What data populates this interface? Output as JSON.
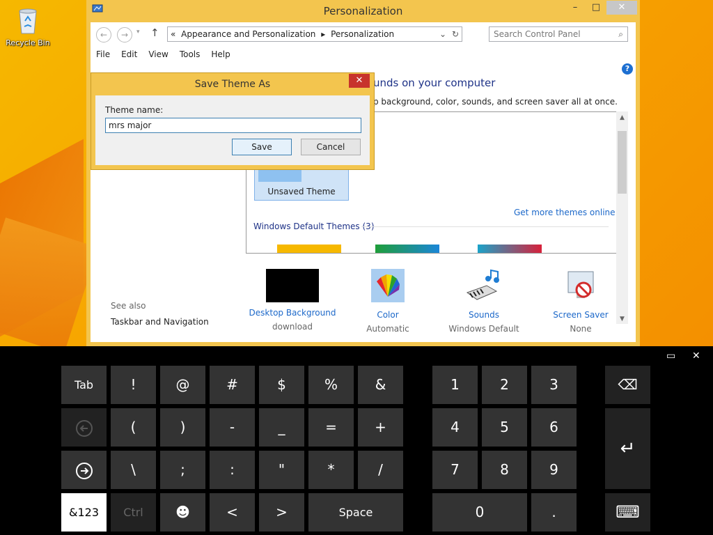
{
  "desktop": {
    "recycle_bin_label": "Recycle Bin"
  },
  "window": {
    "title": "Personalization",
    "controls": {
      "minimize": "–",
      "maximize": "□",
      "close": "✕"
    },
    "breadcrumb": {
      "prefix": "«",
      "items": [
        "Appearance and Personalization",
        "Personalization"
      ]
    },
    "search_placeholder": "Search Control Panel",
    "menu": [
      "File",
      "Edit",
      "View",
      "Tools",
      "Help"
    ],
    "heading": "unds on your computer",
    "subheading": "p background, color, sounds, and screen saver all at once.",
    "unsaved_theme_label": "Unsaved Theme",
    "get_more_themes": "Get more themes online",
    "windows_default_themes": "Windows Default Themes (3)",
    "see_also": "See also",
    "taskbar_navigation": "Taskbar and Navigation",
    "options": [
      {
        "label": "Desktop Background",
        "value": "download",
        "icon": "desktop-background-icon"
      },
      {
        "label": "Color",
        "value": "Automatic",
        "icon": "color-icon"
      },
      {
        "label": "Sounds",
        "value": "Windows Default",
        "icon": "sounds-icon"
      },
      {
        "label": "Screen Saver",
        "value": "None",
        "icon": "screen-saver-icon"
      }
    ],
    "help": "?"
  },
  "dialog": {
    "title": "Save Theme As",
    "close": "✕",
    "field_label": "Theme name:",
    "field_value": "mrs major",
    "save": "Save",
    "cancel": "Cancel"
  },
  "keyboard": {
    "minimize": "▭",
    "close": "✕",
    "symbols_row1": [
      "Tab",
      "!",
      "@",
      "#",
      "$",
      "%",
      "&"
    ],
    "symbols_row2": [
      "",
      "(",
      ")",
      "-",
      "_",
      "=",
      "+"
    ],
    "symbols_row3": [
      "",
      "\\",
      ";",
      ":",
      "\"",
      "*",
      "/"
    ],
    "bottom_row": [
      "&123",
      "Ctrl",
      "",
      "<",
      ">",
      "Space"
    ],
    "numpad": [
      "1",
      "2",
      "3",
      "4",
      "5",
      "6",
      "7",
      "8",
      "9",
      "0",
      "."
    ],
    "backspace": "⌫",
    "enter": "↵",
    "emoji": "☻",
    "keyboard_icon": "⌨"
  }
}
